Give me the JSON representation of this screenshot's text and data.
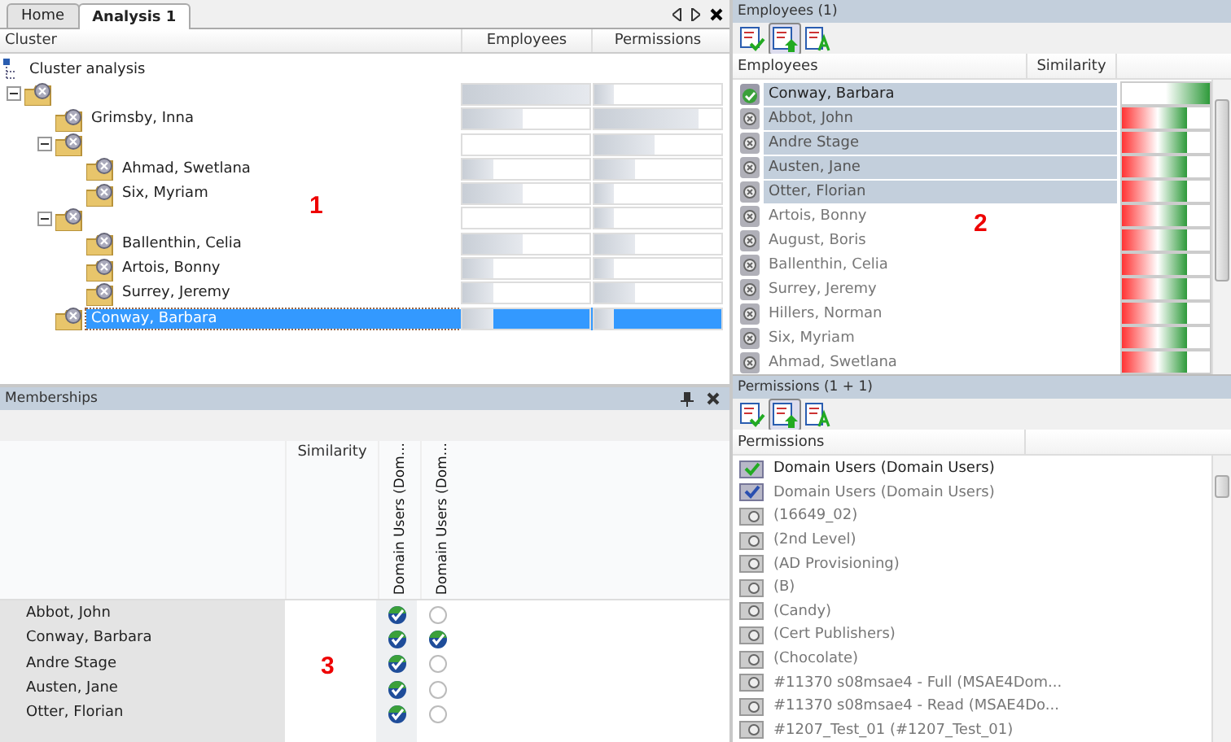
{
  "tabs": [
    {
      "label": "Home",
      "selected": false
    },
    {
      "label": "Analysis 1",
      "selected": true
    }
  ],
  "cluster_table": {
    "columns": [
      "Cluster",
      "Employees",
      "Permissions"
    ],
    "root": "Cluster analysis",
    "tree": [
      {
        "bars": [
          {
            "level": 1.0
          },
          {
            "level": 0.15
          }
        ],
        "selected": false,
        "expanded": true,
        "children": [
          {
            "label": "Grimsby, Inna",
            "bars": [
              {
                "level": 0.48
              },
              {
                "level": 0.82
              }
            ],
            "selected": false
          },
          {
            "bars": [
              {
                "level": 0
              },
              {
                "level": 0.48
              }
            ],
            "selected": false,
            "expanded": true,
            "children": [
              {
                "label": "Ahmad, Swetlana",
                "bars": [
                  {
                    "level": 0.24
                  },
                  {
                    "level": 0.32
                  }
                ],
                "selected": false
              },
              {
                "label": "Six, Myriam",
                "bars": [
                  {
                    "level": 0.48
                  },
                  {
                    "level": 0.15
                  }
                ],
                "selected": false
              }
            ]
          },
          {
            "bars": [
              {
                "level": 0
              },
              {
                "level": 0.15
              }
            ],
            "selected": false,
            "expanded": true,
            "children": [
              {
                "label": "Ballenthin, Celia",
                "bars": [
                  {
                    "level": 0.48
                  },
                  {
                    "level": 0.32
                  }
                ],
                "selected": false
              },
              {
                "label": "Artois, Bonny",
                "bars": [
                  {
                    "level": 0.24
                  },
                  {
                    "level": 0.15
                  }
                ],
                "selected": false
              },
              {
                "label": "Surrey, Jeremy",
                "bars": [
                  {
                    "level": 0.24
                  },
                  {
                    "level": 0.32
                  }
                ],
                "selected": false
              }
            ]
          },
          {
            "label": "Conway, Barbara",
            "bars": [
              {
                "level": 0.24
              },
              {
                "level": 0.15
              }
            ],
            "selected": true
          }
        ]
      }
    ],
    "annotation": "1"
  },
  "memberships": {
    "title": "Memberships",
    "similarity_column": "Similarity",
    "columns": [
      "Domain Users (Dom...",
      "Domain Users (Dom..."
    ],
    "rows": [
      {
        "name": "Abbot, John",
        "members": [
          true,
          false
        ]
      },
      {
        "name": "Conway, Barbara",
        "members": [
          true,
          true
        ]
      },
      {
        "name": "Andre Stage",
        "members": [
          true,
          false
        ]
      },
      {
        "name": "Austen, Jane",
        "members": [
          true,
          false
        ]
      },
      {
        "name": "Otter, Florian",
        "members": [
          true,
          false
        ]
      }
    ],
    "annotation": "3"
  },
  "employees": {
    "title": "Employees (1)",
    "columns": [
      "Employees",
      "Similarity"
    ],
    "rows": [
      {
        "name": "Conway, Barbara",
        "kind": "reference",
        "selected": true,
        "level": 1.0
      },
      {
        "name": "Abbot, John",
        "kind": "other",
        "selected": true,
        "level": 0.74
      },
      {
        "name": "Andre Stage",
        "kind": "other",
        "selected": true,
        "level": 0.74
      },
      {
        "name": "Austen, Jane",
        "kind": "other",
        "selected": true,
        "level": 0.74
      },
      {
        "name": "Otter, Florian",
        "kind": "other",
        "selected": true,
        "level": 0.74
      },
      {
        "name": "Artois, Bonny",
        "kind": "other",
        "selected": false,
        "level": 0.74
      },
      {
        "name": "August, Boris",
        "kind": "other",
        "selected": false,
        "level": 0.74
      },
      {
        "name": "Ballenthin, Celia",
        "kind": "other",
        "selected": false,
        "level": 0.74
      },
      {
        "name": "Surrey, Jeremy",
        "kind": "other",
        "selected": false,
        "level": 0.74
      },
      {
        "name": "Hillers, Norman",
        "kind": "other",
        "selected": false,
        "level": 0.74
      },
      {
        "name": "Six, Myriam",
        "kind": "other",
        "selected": false,
        "level": 0.74
      },
      {
        "name": "Ahmad, Swetlana",
        "kind": "other",
        "selected": false,
        "level": 0.74
      }
    ],
    "annotation": "2"
  },
  "permissions": {
    "title": "Permissions (1 + 1)",
    "columns": [
      "Permissions"
    ],
    "rows": [
      {
        "name": "Domain Users (Domain Users)",
        "kind": "reference"
      },
      {
        "name": "Domain Users (Domain Users)",
        "kind": "partial"
      },
      {
        "name": "(16649_02)",
        "kind": "other"
      },
      {
        "name": "(2nd Level)",
        "kind": "other"
      },
      {
        "name": "(AD Provisioning)",
        "kind": "other"
      },
      {
        "name": "(B)",
        "kind": "other"
      },
      {
        "name": "(Candy)",
        "kind": "other"
      },
      {
        "name": "(Cert Publishers)",
        "kind": "other"
      },
      {
        "name": "(Chocolate)",
        "kind": "other"
      },
      {
        "name": "#11370 s08msae4 - Full (MSAE4Dom...",
        "kind": "other"
      },
      {
        "name": "#11370 s08msae4 - Read (MSAE4Do...",
        "kind": "other"
      },
      {
        "name": "#1207_Test_01 (#1207_Test_01)",
        "kind": "other"
      }
    ]
  }
}
